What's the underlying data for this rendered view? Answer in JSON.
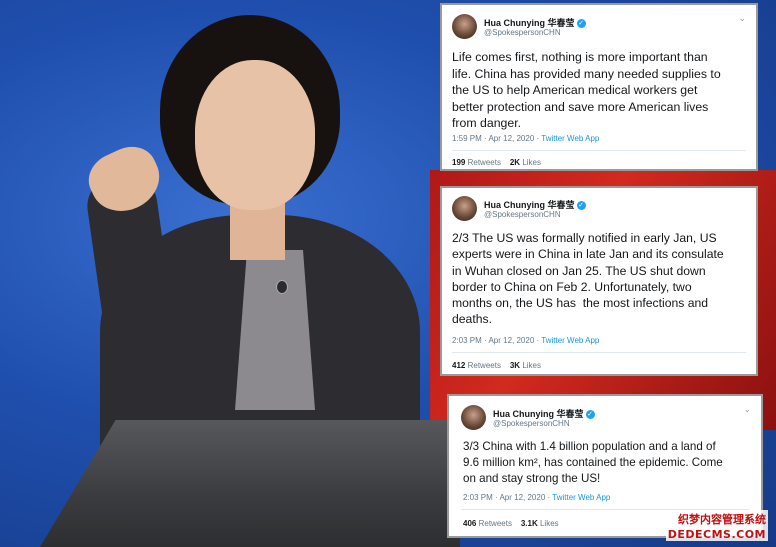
{
  "tweets": [
    {
      "name": "Hua Chunying 华春莹",
      "handle": "@SpokespersonCHN",
      "text": "Life comes first, nothing is more important than\nlife. China has provided many needed supplies to\nthe US to help American medical workers get\nbetter protection and save more American lives\nfrom danger.",
      "time": "1:59 PM · Apr 12, 2020",
      "app": "Twitter Web App",
      "retweets": "199",
      "retweets_label": "Retweets",
      "likes": "2K",
      "likes_label": "Likes"
    },
    {
      "name": "Hua Chunying 华春莹",
      "handle": "@SpokespersonCHN",
      "text": "2/3 The US was formally notified in early Jan, US\nexperts were in China in late Jan and its consulate\nin Wuhan closed on Jan 25. The US shut down\nborder to China on Feb 2. Unfortunately, two\nmonths on, the US has  the most infections and\ndeaths.",
      "time": "2:03 PM · Apr 12, 2020",
      "app": "Twitter Web App",
      "retweets": "412",
      "retweets_label": "Retweets",
      "likes": "3K",
      "likes_label": "Likes"
    },
    {
      "name": "Hua Chunying 华春莹",
      "handle": "@SpokespersonCHN",
      "text": "3/3 China with 1.4 billion population and a land of\n9.6 million km², has contained the epidemic. Come\non and stay strong the US!",
      "time": "2:03 PM · Apr 12, 2020",
      "app": "Twitter Web App",
      "retweets": "406",
      "retweets_label": "Retweets",
      "likes": "3.1K",
      "likes_label": "Likes"
    }
  ],
  "icons": {
    "verified": "verified-badge-icon",
    "chevron": "chevron-down-icon"
  },
  "watermark": {
    "line1": "织梦内容管理系统",
    "line2": "DEDECMS.COM"
  },
  "colors": {
    "twitter_blue": "#1da1f2",
    "link_blue": "#1b95e0",
    "muted": "#657786",
    "watermark_red": "#c01010"
  }
}
